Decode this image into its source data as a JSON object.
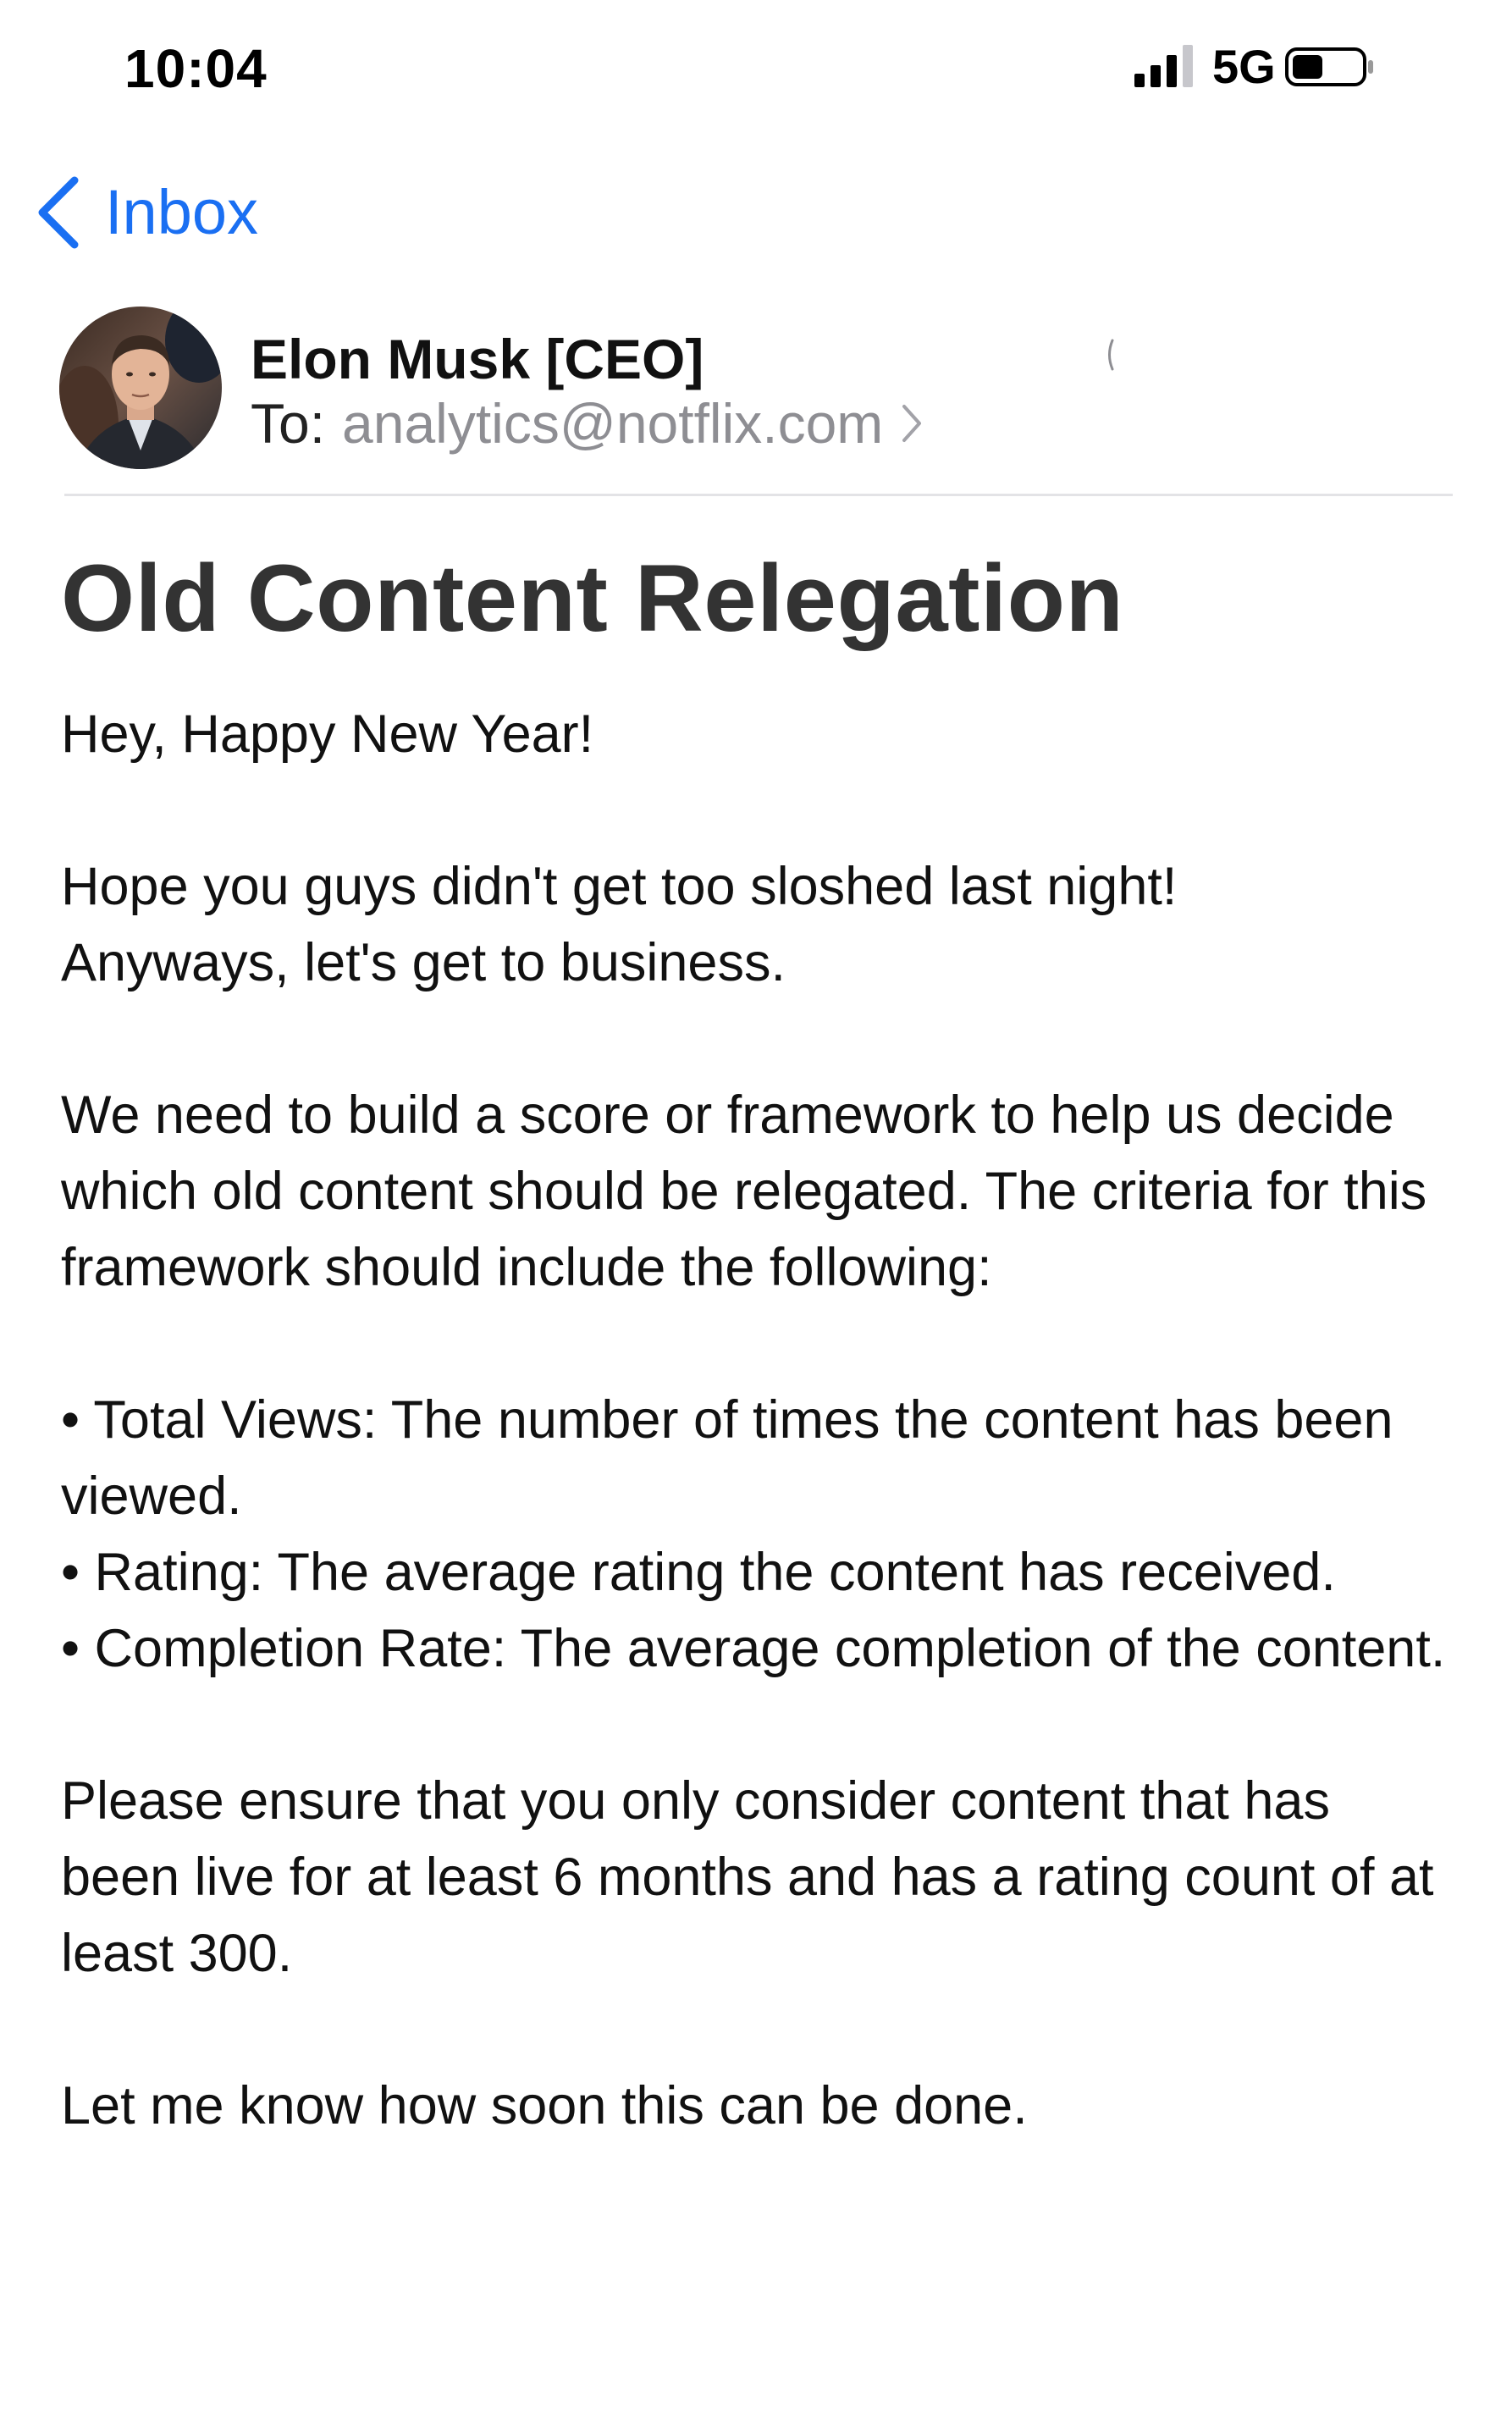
{
  "status_bar": {
    "time": "10:04",
    "network": "5G",
    "signal_bars": 3,
    "battery_level": 0.45
  },
  "nav": {
    "back_label": "Inbox"
  },
  "header": {
    "sender": "Elon Musk [CEO]",
    "to_label": "To:",
    "to_address": "analytics@notflix.com"
  },
  "email": {
    "subject": "Old Content Relegation",
    "greeting": "Hey, Happy New Year!",
    "para1_line1": "Hope you guys didn't get too sloshed last night!",
    "para1_line2": "Anyways, let's get to business.",
    "para2": "We need to build a score or framework to help us decide which old content should be relegated. The criteria for this framework should include the following:",
    "bullets": [
      "• Total Views: The number of times the content has been viewed.",
      "• Rating: The average rating the content has received.",
      "• Completion Rate: The average completion of the content."
    ],
    "para3": "Please ensure that you only consider content that has been live for at least 6 months and has a rating count of at least 300.",
    "closing": "Let me know how soon this can be done."
  },
  "colors": {
    "accent": "#1a6ff2",
    "secondary_text": "#8e8e93",
    "subject_text": "#333333"
  },
  "icons": {
    "back": "chevron-left-icon",
    "recipient_disclosure": "chevron-right-icon",
    "signal": "signal-bars-icon",
    "battery": "battery-icon"
  }
}
